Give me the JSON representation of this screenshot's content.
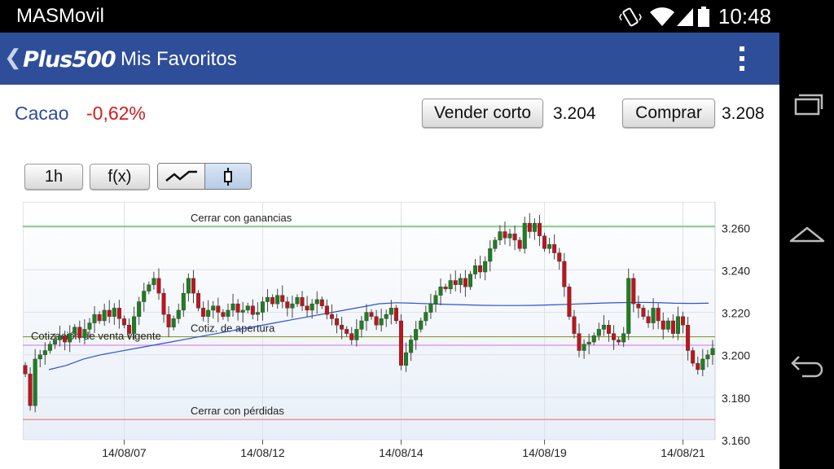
{
  "status_bar": {
    "carrier": "MASMovil",
    "time": "10:48",
    "icons": [
      "vibrate-icon",
      "wifi-icon",
      "signal-icon",
      "battery-icon"
    ]
  },
  "app_bar": {
    "logo": "Plus500",
    "title": "Mis Favoritos",
    "icons": [
      "back-arrow-icon",
      "overflow-menu-icon"
    ],
    "color": "#2f4e9a"
  },
  "instrument": {
    "name": "Cacao",
    "change": "-0,62%",
    "change_color": "#d31c1c"
  },
  "trade": {
    "sell_label": "Vender corto",
    "sell_price": "3.204",
    "buy_label": "Comprar",
    "buy_price": "3.208"
  },
  "chart_toolbar": {
    "timeframe": "1h",
    "functions": "f(x)",
    "chart_modes": [
      "line-chart-icon",
      "candlestick-icon"
    ],
    "selected_mode": "candlestick"
  },
  "nav_bar": {
    "icons": [
      "recent-apps-icon",
      "home-icon",
      "back-icon"
    ]
  },
  "chart_data": {
    "type": "candlestick",
    "ylim": [
      3.16,
      3.272
    ],
    "y_ticks": [
      "3.160",
      "3.180",
      "3.200",
      "3.220",
      "3.240",
      "3.260"
    ],
    "y_tick_values": [
      3.16,
      3.18,
      3.2,
      3.22,
      3.24,
      3.26
    ],
    "x_tick_labels": [
      "14/08/07",
      "14/08/12",
      "14/08/14",
      "14/08/19",
      "14/08/21"
    ],
    "x_tick_index": [
      20,
      48,
      76,
      105,
      133
    ],
    "bar_count": 140,
    "colors": {
      "up": "#1e7f1e",
      "down": "#c0141c",
      "ma": "#2f4fd8"
    },
    "levels": [
      {
        "label": "Cerrar con ganancias",
        "value": 3.2605,
        "color": "#4fc04f"
      },
      {
        "label": "Cotiz. de apertura",
        "value": 3.2085,
        "color": "#8a9a2a"
      },
      {
        "label": "Cotización de venta vigente",
        "value": 3.2045,
        "color": "#e08ae0"
      },
      {
        "label": "Cerrar con pérdidas",
        "value": 3.1695,
        "color": "#f08080"
      }
    ],
    "closes": [
      3.191,
      3.176,
      3.198,
      3.2,
      3.202,
      3.205,
      3.207,
      3.209,
      3.206,
      3.21,
      3.213,
      3.208,
      3.212,
      3.215,
      3.219,
      3.216,
      3.221,
      3.218,
      3.222,
      3.217,
      3.214,
      3.21,
      3.218,
      3.225,
      3.23,
      3.233,
      3.236,
      3.229,
      3.219,
      3.213,
      3.217,
      3.221,
      3.229,
      3.236,
      3.229,
      3.222,
      3.218,
      3.221,
      3.223,
      3.22,
      3.218,
      3.221,
      3.224,
      3.22,
      3.221,
      3.223,
      3.219,
      3.22,
      3.225,
      3.227,
      3.224,
      3.228,
      3.225,
      3.222,
      3.224,
      3.227,
      3.223,
      3.221,
      3.224,
      3.226,
      3.223,
      3.219,
      3.217,
      3.214,
      3.212,
      3.21,
      3.207,
      3.212,
      3.216,
      3.22,
      3.218,
      3.214,
      3.217,
      3.219,
      3.222,
      3.216,
      3.195,
      3.201,
      3.207,
      3.212,
      3.216,
      3.22,
      3.224,
      3.228,
      3.232,
      3.231,
      3.235,
      3.233,
      3.236,
      3.232,
      3.238,
      3.242,
      3.239,
      3.244,
      3.25,
      3.254,
      3.258,
      3.255,
      3.257,
      3.254,
      3.25,
      3.262,
      3.258,
      3.262,
      3.256,
      3.25,
      3.252,
      3.248,
      3.244,
      3.232,
      3.218,
      3.21,
      3.202,
      3.205,
      3.206,
      3.209,
      3.212,
      3.214,
      3.21,
      3.207,
      3.206,
      3.21,
      3.236,
      3.224,
      3.222,
      3.218,
      3.215,
      3.222,
      3.216,
      3.212,
      3.216,
      3.21,
      3.218,
      3.214,
      3.202,
      3.196,
      3.193,
      3.198,
      3.2,
      3.203
    ],
    "ma": [
      3.193,
      3.195,
      3.198,
      3.2,
      3.2015,
      3.203,
      3.2045,
      3.206,
      3.2075,
      3.209,
      3.2105,
      3.212,
      3.2135,
      3.215,
      3.2165,
      3.218,
      3.2195,
      3.221,
      3.2225,
      3.224,
      3.2245,
      3.2243,
      3.224,
      3.2237,
      3.2235,
      3.2233,
      3.2232,
      3.2232,
      3.2233,
      3.2235,
      3.2238,
      3.2241,
      3.2244,
      3.2246,
      3.2247,
      3.2246,
      3.2243,
      3.2242,
      3.2243
    ]
  }
}
